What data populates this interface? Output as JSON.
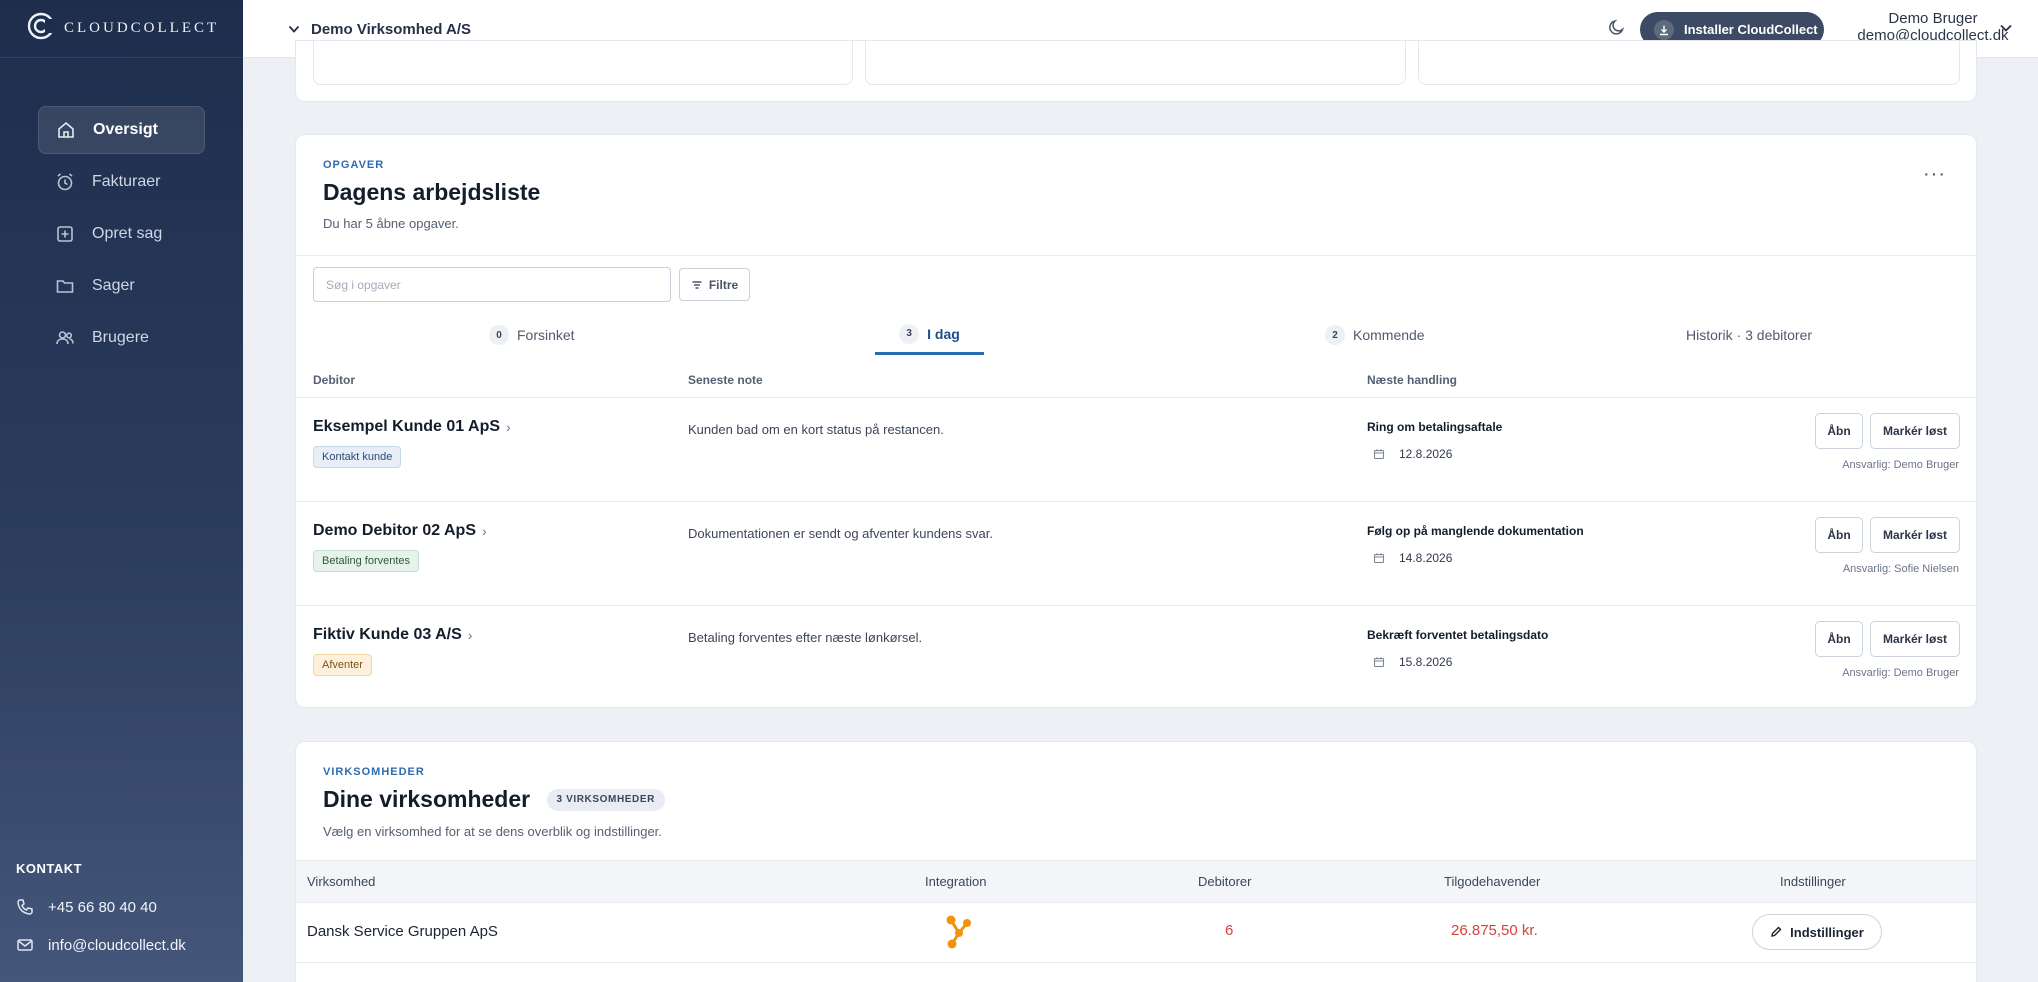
{
  "sidebar": {
    "logo_text": "CLOUDCOLLECT",
    "items": [
      {
        "label": "Oversigt",
        "icon": "home-icon",
        "active": true
      },
      {
        "label": "Fakturaer",
        "icon": "alarm-clock-icon"
      },
      {
        "label": "Opret sag",
        "icon": "plus-square-icon"
      },
      {
        "label": "Sager",
        "icon": "folder-icon"
      },
      {
        "label": "Brugere",
        "icon": "users-icon"
      }
    ],
    "contact": {
      "title": "KONTAKT",
      "phone": "+45 66 80 40 40",
      "email": "info@cloudcollect.dk"
    }
  },
  "topbar": {
    "company": "Demo Virksomhed A/S",
    "install_label": "Installer CloudCollect",
    "user_name": "Demo Bruger",
    "user_email": "demo@cloudcollect.dk"
  },
  "tasks": {
    "eyebrow": "OPGAVER",
    "title": "Dagens arbejdsliste",
    "subtitle": "Du har 5 åbne opgaver.",
    "search_placeholder": "Søg i opgaver",
    "filter_label": "Filtre",
    "tabs": [
      {
        "count": "0",
        "label": "Forsinket"
      },
      {
        "count": "3",
        "label": "I dag",
        "active": true
      },
      {
        "count": "2",
        "label": "Kommende"
      },
      {
        "label": "Historik · 3 debitorer"
      }
    ],
    "columns": {
      "debitor": "Debitor",
      "note": "Seneste note",
      "next": "Næste handling"
    },
    "rows": [
      {
        "debitor": "Eksempel Kunde 01 ApS",
        "badge": "Kontakt kunde",
        "note": "Kunden bad om en kort status på restancen.",
        "action": "Ring om betalingsaftale",
        "date": "12.8.2026",
        "open": "Åbn",
        "resolve": "Markér løst",
        "responsible": "Ansvarlig: Demo Bruger"
      },
      {
        "debitor": "Demo Debitor 02 ApS",
        "badge": "Betaling forventes",
        "note": "Dokumentationen er sendt og afventer kundens svar.",
        "action": "Følg op på manglende dokumentation",
        "date": "14.8.2026",
        "open": "Åbn",
        "resolve": "Markér løst",
        "responsible": "Ansvarlig: Sofie Nielsen"
      },
      {
        "debitor": "Fiktiv Kunde 03 A/S",
        "badge": "Afventer",
        "note": "Betaling forventes efter næste lønkørsel.",
        "action": "Bekræft forventet betalingsdato",
        "date": "15.8.2026",
        "open": "Åbn",
        "resolve": "Markér løst",
        "responsible": "Ansvarlig: Demo Bruger"
      }
    ]
  },
  "companies": {
    "eyebrow": "VIRKSOMHEDER",
    "title": "Dine virksomheder",
    "count_label": "3 VIRKSOMHEDER",
    "subtitle": "Vælg en virksomhed for at se dens overblik og indstillinger.",
    "columns": {
      "company": "Virksomhed",
      "integration": "Integration",
      "debtors": "Debitorer",
      "receivables": "Tilgodehavender",
      "settings": "Indstillinger"
    },
    "rows": [
      {
        "name": "Dansk Service Gruppen ApS",
        "debtors": "6",
        "receivables": "26.875,50 kr.",
        "settings_label": "Indstillinger"
      }
    ]
  },
  "colors": {
    "sidebar": "#1e2d4c",
    "accent": "#2a6cb3",
    "negative": "#d6433a",
    "integration": "#f0940f"
  }
}
